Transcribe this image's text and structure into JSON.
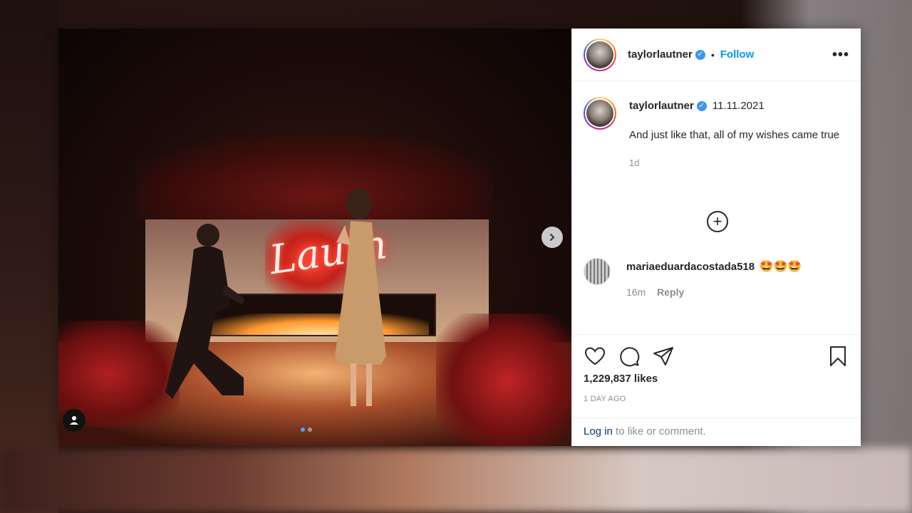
{
  "post": {
    "author": {
      "username": "taylorlautner",
      "verified": true
    },
    "header": {
      "separator": "•",
      "follow_label": "Follow",
      "more_label": "•••"
    },
    "caption": {
      "username": "taylorlautner",
      "date": "11.11.2021",
      "text": "And just like that, all of my wishes came true",
      "time_ago": "1d"
    },
    "photo": {
      "neon_text": "Lautn",
      "carousel_dots": 2,
      "active_dot": 1
    },
    "comment": {
      "username": "mariaeduardacostada518",
      "emojis": "🤩🤩🤩",
      "time_ago": "16m",
      "reply_label": "Reply"
    },
    "load_more_label": "+",
    "likes_text": "1,229,837 likes",
    "post_age": "1 DAY AGO",
    "login": {
      "link": "Log in",
      "suffix": " to like or comment."
    },
    "colors": {
      "follow": "#0095f6",
      "verified": "#3897f0",
      "login_link": "#00376b",
      "muted": "#8e8e8e",
      "text": "#262626"
    }
  }
}
